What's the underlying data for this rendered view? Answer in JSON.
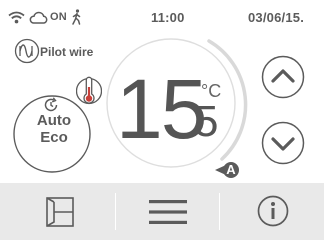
{
  "status": {
    "wifi_icon": "wifi-icon",
    "cloud_icon": "cloud-icon",
    "power_state": "ON",
    "presence_icon": "person-walking-icon",
    "time": "11:00",
    "date": "03/06/15."
  },
  "pilot": {
    "label": "Pilot wire",
    "icon": "pilot-wire-icon"
  },
  "temperature": {
    "whole": "15",
    "decimal": "5",
    "unit": "°C"
  },
  "mode": {
    "line1": "Auto",
    "line2": "Eco",
    "icon": "auto-clock-icon"
  },
  "badge": {
    "label": "A"
  },
  "colors": {
    "accent": "#5b5b5b",
    "ring": "#dcdcdc",
    "bar": "#e9e9e9"
  }
}
